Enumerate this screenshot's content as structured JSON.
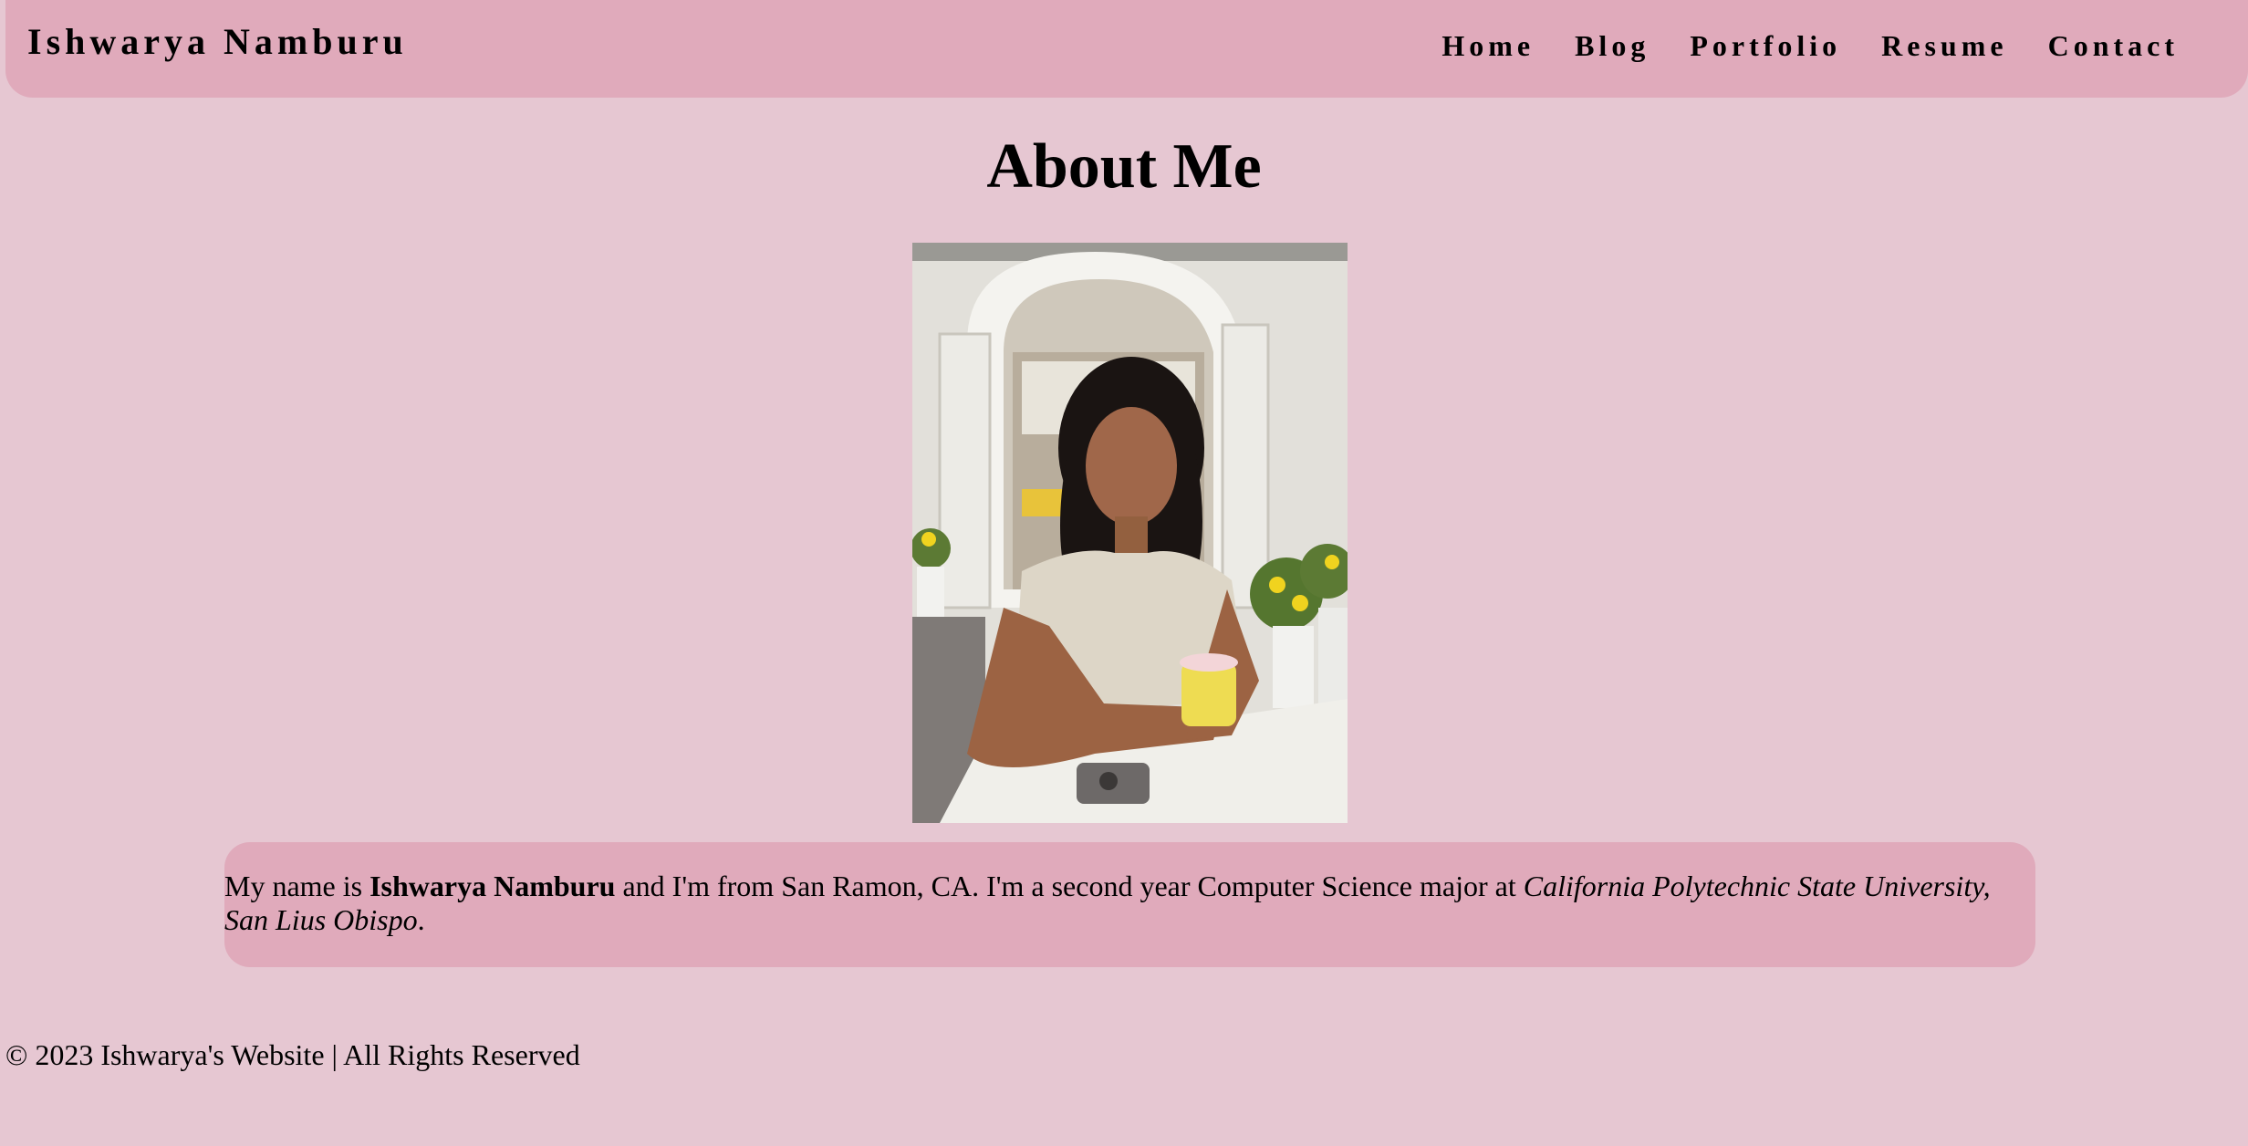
{
  "header": {
    "brand": "Ishwarya Namburu",
    "nav": [
      "Home",
      "Blog",
      "Portfolio",
      "Resume",
      "Contact"
    ]
  },
  "main": {
    "title": "About Me",
    "photo_alt": "Ishwarya Namburu",
    "about": {
      "prefix": "My name is ",
      "name": "Ishwarya Namburu",
      "middle": " and I'm from San Ramon, CA. I'm a second year Computer Science major at ",
      "school": "California Polytechnic State University, San Lius Obispo",
      "suffix": "."
    }
  },
  "footer": {
    "text": "© 2023 Ishwarya's Website | All Rights Reserved"
  },
  "colors": {
    "background": "#e6c7d2",
    "accent": "#e0aabb"
  }
}
